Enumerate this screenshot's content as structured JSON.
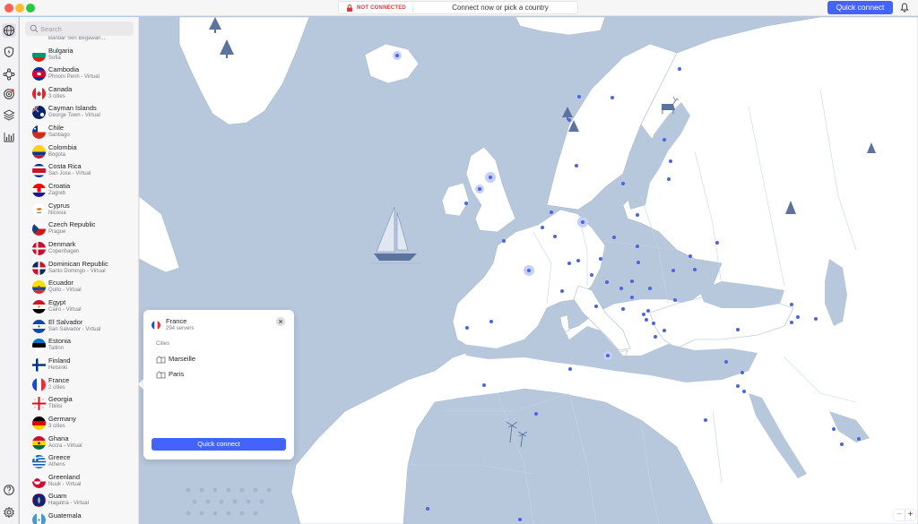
{
  "titlebar": {
    "status": "NOT CONNECTED",
    "hint": "Connect now or pick a country",
    "quick_connect": "Quick connect"
  },
  "search": {
    "placeholder": "Search"
  },
  "countries": [
    {
      "name": "Bulgaria",
      "sub": "Sofia"
    },
    {
      "name": "Cambodia",
      "sub": "Phnom Penh - Virtual"
    },
    {
      "name": "Canada",
      "sub": "3 cities"
    },
    {
      "name": "Cayman Islands",
      "sub": "George Town - Virtual"
    },
    {
      "name": "Chile",
      "sub": "Santiago"
    },
    {
      "name": "Colombia",
      "sub": "Bogota"
    },
    {
      "name": "Costa Rica",
      "sub": "San Jose - Virtual"
    },
    {
      "name": "Croatia",
      "sub": "Zagreb"
    },
    {
      "name": "Cyprus",
      "sub": "Nicosia"
    },
    {
      "name": "Czech Republic",
      "sub": "Prague"
    },
    {
      "name": "Denmark",
      "sub": "Copenhagen"
    },
    {
      "name": "Dominican Republic",
      "sub": "Santo Domingo - Virtual"
    },
    {
      "name": "Ecuador",
      "sub": "Quito - Virtual"
    },
    {
      "name": "Egypt",
      "sub": "Cairo - Virtual"
    },
    {
      "name": "El Salvador",
      "sub": "San Salvador - Virtual"
    },
    {
      "name": "Estonia",
      "sub": "Tallinn"
    },
    {
      "name": "Finland",
      "sub": "Helsinki"
    },
    {
      "name": "France",
      "sub": "2 cities"
    },
    {
      "name": "Georgia",
      "sub": "Tbilisi"
    },
    {
      "name": "Germany",
      "sub": "3 cities"
    },
    {
      "name": "Ghana",
      "sub": "Accra - Virtual"
    },
    {
      "name": "Greece",
      "sub": "Athens"
    },
    {
      "name": "Greenland",
      "sub": "Nuuk - Virtual"
    },
    {
      "name": "Guam",
      "sub": "Hagatna - Virtual"
    },
    {
      "name": "Guatemala",
      "sub": ""
    }
  ],
  "cut_row": "Bandar Seri Begawan...",
  "popup": {
    "country": "France",
    "servers": "294 servers",
    "cities_label": "Cities",
    "cities": [
      "Marseille",
      "Paris"
    ],
    "quick_connect": "Quick connect"
  },
  "zoom": {
    "out": "−",
    "in": "+"
  },
  "colors": {
    "accent": "#4264fb",
    "status_red": "#d93b3b",
    "land": "#ffffff",
    "water": "#b8c8dc",
    "server_dot": "#4a64e8"
  }
}
